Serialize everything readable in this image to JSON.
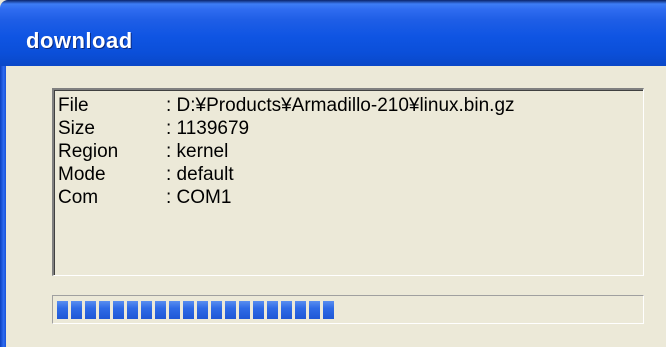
{
  "window": {
    "title": "download"
  },
  "info": {
    "rows": [
      {
        "label": "File",
        "value": ": D:¥Products¥Armadillo-210¥linux.bin.gz"
      },
      {
        "label": "Size",
        "value": ": 1139679"
      },
      {
        "label": "Region",
        "value": ": kernel"
      },
      {
        "label": "Mode",
        "value": ": default"
      },
      {
        "label": "Com",
        "value": ": COM1"
      }
    ]
  },
  "progress": {
    "fraction": 0.49,
    "color": "#2f6be6"
  }
}
